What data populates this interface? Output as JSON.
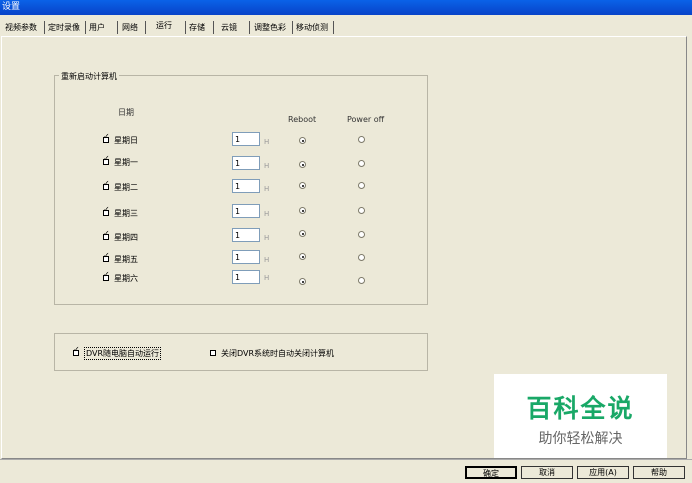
{
  "window": {
    "title": "设置"
  },
  "tabs": [
    {
      "label": "视频参数"
    },
    {
      "label": "定时录像"
    },
    {
      "label": "用户"
    },
    {
      "label": "网络"
    },
    {
      "label": "运行"
    },
    {
      "label": "存储"
    },
    {
      "label": "云镜"
    },
    {
      "label": "调整色彩"
    },
    {
      "label": "移动侦测"
    }
  ],
  "restart_group": {
    "title": "重新启动计算机",
    "day_header": "日期",
    "reboot_header": "Reboot",
    "poweroff_header": "Power off",
    "hour_unit": "H",
    "rows": [
      {
        "day": "星期日",
        "checked": true,
        "hour": "1",
        "mode": "reboot"
      },
      {
        "day": "星期一",
        "checked": true,
        "hour": "1",
        "mode": "reboot"
      },
      {
        "day": "星期二",
        "checked": true,
        "hour": "1",
        "mode": "reboot"
      },
      {
        "day": "星期三",
        "checked": true,
        "hour": "1",
        "mode": "reboot"
      },
      {
        "day": "星期四",
        "checked": true,
        "hour": "1",
        "mode": "reboot"
      },
      {
        "day": "星期五",
        "checked": true,
        "hour": "1",
        "mode": "reboot"
      },
      {
        "day": "星期六",
        "checked": true,
        "hour": "1",
        "mode": "reboot"
      }
    ]
  },
  "options": {
    "autorun_label": "DVR随电脑自动运行",
    "autorun_checked": true,
    "shutdown_label": "关闭DVR系统时自动关闭计算机",
    "shutdown_checked": false
  },
  "buttons": {
    "ok": "确定",
    "cancel": "取消",
    "apply": "应用(A)",
    "help": "帮助"
  },
  "watermark": {
    "big": "百科全说",
    "small": "助你轻松解决"
  }
}
